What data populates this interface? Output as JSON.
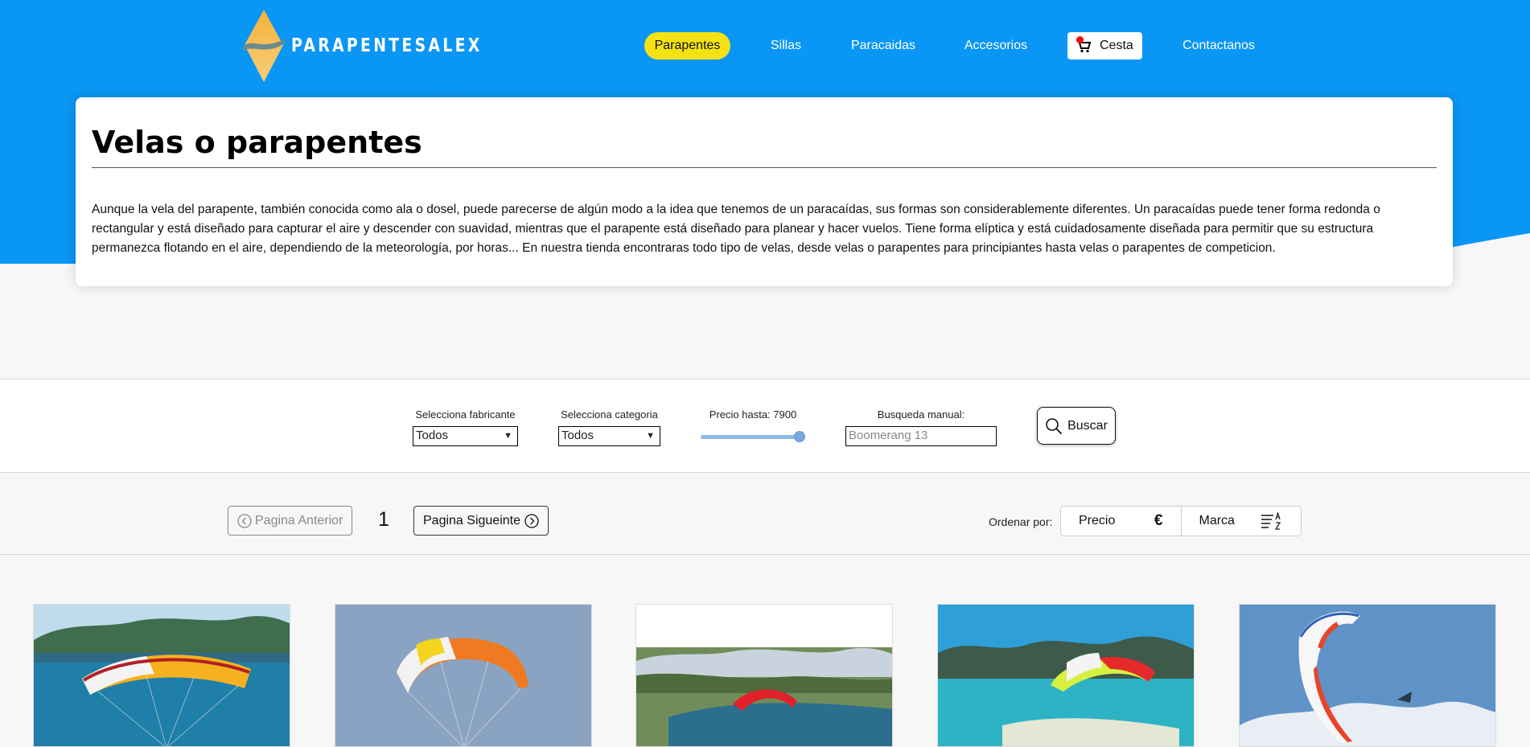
{
  "brand": {
    "name": "PARAPENTESALEX"
  },
  "nav": {
    "items": [
      {
        "label": "Parapentes",
        "active": true
      },
      {
        "label": "Sillas"
      },
      {
        "label": "Paracaidas"
      },
      {
        "label": "Accesorios"
      },
      {
        "label": "Contactanos"
      }
    ],
    "cart_label": "Cesta"
  },
  "intro": {
    "title": "Velas o parapentes",
    "text": "Aunque la vela del parapente, también conocida como ala o dosel, puede parecerse de algún modo a la idea que tenemos de un paracaídas, sus formas son considerablemente diferentes. Un paracaídas puede tener forma redonda o rectangular y está diseñado para capturar el aire y descender con suavidad, mientras que el parapente está diseñado para planear y hacer vuelos. Tiene forma elíptica y está cuidadosamente diseñada para permitir que su estructura permanezca flotando en el aire, dependiendo de la meteorología, por horas... En nuestra tienda encontraras todo tipo de velas, desde velas o parapentes para principiantes hasta velas o parapentes de competicion."
  },
  "filters": {
    "manufacturer_label": "Selecciona fabricante",
    "manufacturer_value": "Todos",
    "category_label": "Selecciona categoria",
    "category_value": "Todos",
    "price_label": "Precio hasta: 7900",
    "price_max_value": 7900,
    "price_slider_fraction": 1.0,
    "search_label": "Busqueda manual:",
    "search_placeholder": "Boomerang 13",
    "search_button": "Buscar"
  },
  "pagination": {
    "prev_label": "Pagina Anterior",
    "current_page": "1",
    "next_label": "Pagina Sigueinte"
  },
  "sort": {
    "label": "Ordenar por:",
    "options": [
      {
        "label": "Precio",
        "symbol": "€"
      },
      {
        "label": "Marca",
        "icon": "sort-alpha-icon"
      }
    ]
  },
  "colors": {
    "header_blue": "#0a96f5",
    "active_nav": "#f4e214",
    "background": "#f7f7f7"
  },
  "products": [
    {
      "image": "paraglider-orange-red-over-lake"
    },
    {
      "image": "paraglider-orange-yellow-sky"
    },
    {
      "image": "paraglider-red-over-mountains"
    },
    {
      "image": "paraglider-lime-red-coast"
    },
    {
      "image": "paraglider-white-red-snowy-peaks"
    }
  ]
}
